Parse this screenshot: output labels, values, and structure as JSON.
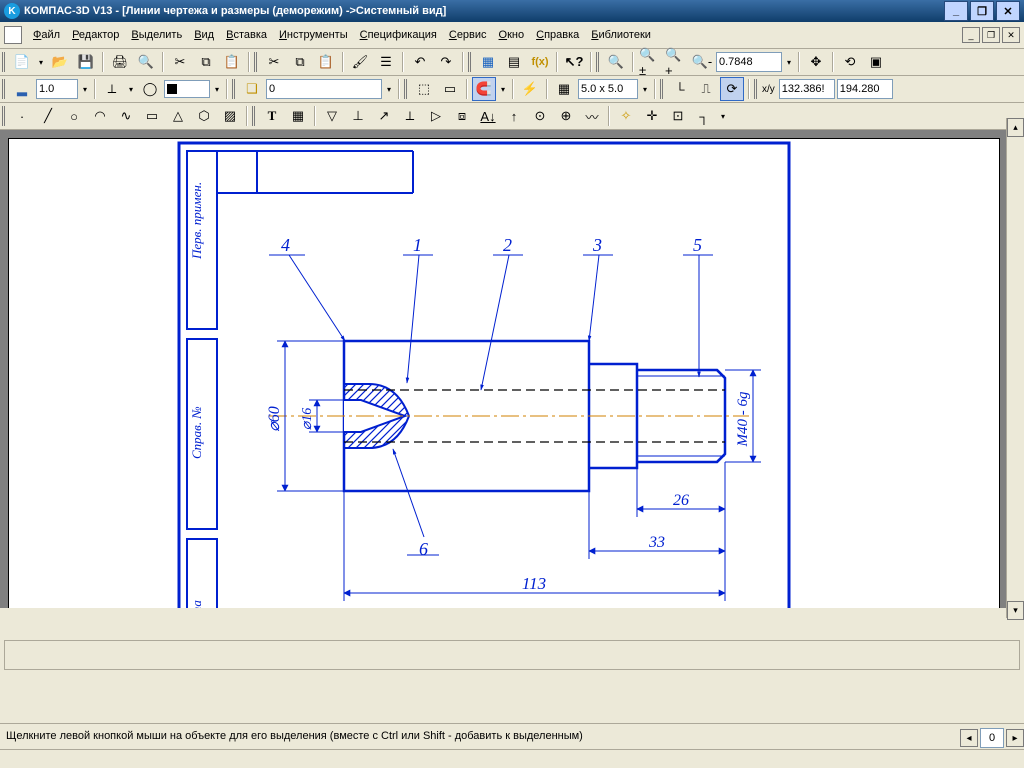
{
  "title": "КОМПАС-3D V13 - [Линии чертежа и размеры (деморежим) ->Системный вид]",
  "menu": [
    "Файл",
    "Редактор",
    "Выделить",
    "Вид",
    "Вставка",
    "Инструменты",
    "Спецификация",
    "Сервис",
    "Окно",
    "Справка",
    "Библиотеки"
  ],
  "tb1": {
    "zoom_value": "0.7848"
  },
  "tb2": {
    "line_width": "1.0",
    "layer": "0",
    "grid": "5.0 x 5.0"
  },
  "coords": {
    "x": "132.386!",
    "y": "194.280"
  },
  "status": "Щелкните левой кнопкой мыши на объекте для его выделения (вместе с Ctrl или Shift - добавить к выделенным)",
  "drawing": {
    "callouts": [
      "4",
      "1",
      "2",
      "3",
      "5",
      "6"
    ],
    "dims": {
      "d60": "⌀60",
      "d16": "⌀16",
      "l113": "113",
      "l33": "33",
      "l26": "26",
      "m40": "M40 - 6g"
    },
    "side_labels": {
      "top": "Перв. примен.",
      "mid": "Справ. №",
      "bot": "и дата"
    }
  },
  "status_spin": "0"
}
